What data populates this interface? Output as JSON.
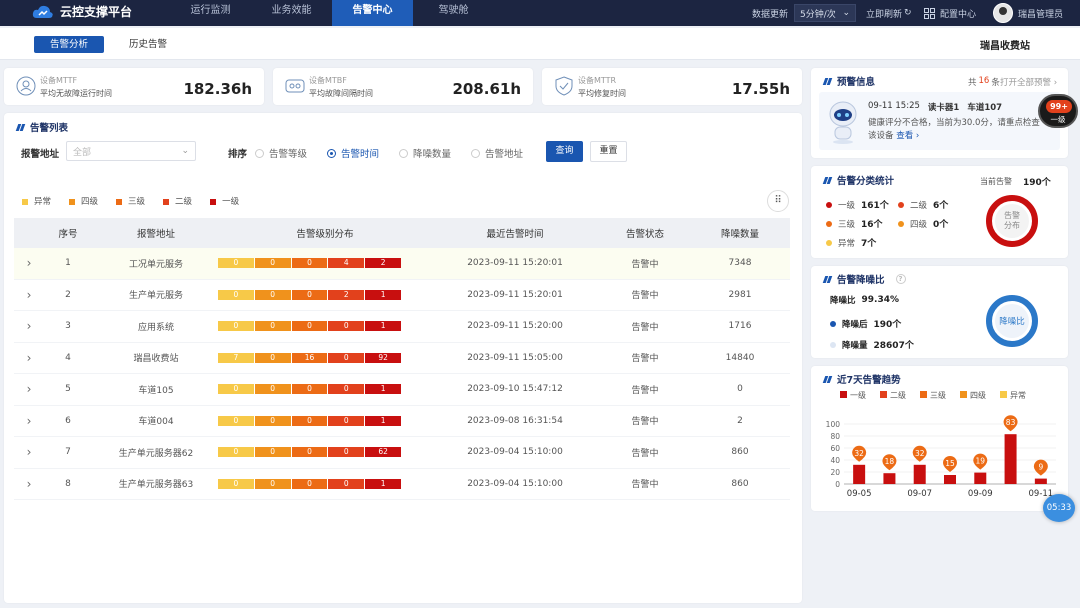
{
  "app": {
    "title": "云控支撑平台"
  },
  "nav": [
    {
      "label": "运行监测"
    },
    {
      "label": "业务效能"
    },
    {
      "label": "告警中心"
    },
    {
      "label": "驾驶舱"
    }
  ],
  "topright": {
    "refresh_label": "数据更新",
    "interval": "5分钟/次",
    "refresh_now": "立即刷新",
    "config": "配置中心",
    "user": "瑞昌管理员"
  },
  "subtabs": [
    {
      "label": "告警分析"
    },
    {
      "label": "历史告警"
    }
  ],
  "station": "瑞昌收费站",
  "kpis": [
    {
      "name": "设备MTTF",
      "desc": "平均无故障运行时间",
      "value": "182.36h"
    },
    {
      "name": "设备MTBF",
      "desc": "平均故障间隔时间",
      "value": "208.61h"
    },
    {
      "name": "设备MTTR",
      "desc": "平均修复时间",
      "value": "17.55h"
    }
  ],
  "alarm_list": {
    "title": "告警列表",
    "address_label": "报警地址",
    "address_placeholder": "全部",
    "sort_label": "排序",
    "sort_options": [
      "告警等级",
      "告警时间",
      "降噪数量",
      "告警地址"
    ],
    "sort_selected": "告警时间",
    "query_btn": "查询",
    "reset_btn": "重置",
    "legend": [
      "异常",
      "四级",
      "三级",
      "二级",
      "一级"
    ],
    "legend_colors": [
      "#f7c948",
      "#f0921c",
      "#ec6b15",
      "#e2411c",
      "#c80f0f"
    ],
    "columns": [
      "序号",
      "报警地址",
      "告警级别分布",
      "最近告警时间",
      "告警状态",
      "降噪数量"
    ],
    "rows": [
      {
        "no": "1",
        "addr": "工况单元服务",
        "levels": [
          "0",
          "0",
          "0",
          "4",
          "2"
        ],
        "time": "2023-09-11 15:20:01",
        "status": "告警中",
        "count": "7348"
      },
      {
        "no": "2",
        "addr": "生产单元服务",
        "levels": [
          "0",
          "0",
          "0",
          "2",
          "1"
        ],
        "time": "2023-09-11 15:20:01",
        "status": "告警中",
        "count": "2981"
      },
      {
        "no": "3",
        "addr": "应用系统",
        "levels": [
          "0",
          "0",
          "0",
          "0",
          "1"
        ],
        "time": "2023-09-11 15:20:00",
        "status": "告警中",
        "count": "1716"
      },
      {
        "no": "4",
        "addr": "瑞昌收费站",
        "levels": [
          "7",
          "0",
          "16",
          "0",
          "92"
        ],
        "time": "2023-09-11 15:05:00",
        "status": "告警中",
        "count": "14840"
      },
      {
        "no": "5",
        "addr": "车道105",
        "levels": [
          "0",
          "0",
          "0",
          "0",
          "1"
        ],
        "time": "2023-09-10 15:47:12",
        "status": "告警中",
        "count": "0"
      },
      {
        "no": "6",
        "addr": "车道004",
        "levels": [
          "0",
          "0",
          "0",
          "0",
          "1"
        ],
        "time": "2023-09-08 16:31:54",
        "status": "告警中",
        "count": "2"
      },
      {
        "no": "7",
        "addr": "生产单元服务器62",
        "levels": [
          "0",
          "0",
          "0",
          "0",
          "62"
        ],
        "time": "2023-09-04 15:10:00",
        "status": "告警中",
        "count": "860"
      },
      {
        "no": "8",
        "addr": "生产单元服务器63",
        "levels": [
          "0",
          "0",
          "0",
          "0",
          "1"
        ],
        "time": "2023-09-04 15:10:00",
        "status": "告警中",
        "count": "860"
      }
    ]
  },
  "warning_info": {
    "title": "预警信息",
    "total_prefix": "共",
    "total": "16",
    "total_suffix": "条",
    "open_all": "打开全部预警",
    "time": "09-11 15:25",
    "device": "读卡器1",
    "lane": "车道107",
    "message": "健康评分不合格，当前为30.0分，请重点检查该设备",
    "view": "查看",
    "badge": "99+",
    "badge_sub": "一级"
  },
  "category_stats": {
    "title": "告警分类统计",
    "current_label": "当前告警",
    "current_value": "190个",
    "items": [
      {
        "label": "一级",
        "value": "161个",
        "color": "#c80f0f"
      },
      {
        "label": "二级",
        "value": "6个",
        "color": "#e2411c"
      },
      {
        "label": "三级",
        "value": "16个",
        "color": "#ec6b15"
      },
      {
        "label": "四级",
        "value": "0个",
        "color": "#f0921c"
      },
      {
        "label": "异常",
        "value": "7个",
        "color": "#f7c948"
      }
    ],
    "donut_label1": "告警",
    "donut_label2": "分布"
  },
  "noise": {
    "title": "告警降噪比",
    "ratio_label": "降噪比",
    "ratio": "99.34%",
    "after_label": "降噪后",
    "after": "190个",
    "amount_label": "降噪量",
    "amount": "28607个",
    "donut_label": "降噪比"
  },
  "chart_data": {
    "type": "bar",
    "title": "近7天告警趋势",
    "legend": [
      "一级",
      "二级",
      "三级",
      "四级",
      "异常"
    ],
    "legend_colors": [
      "#c80f0f",
      "#e2411c",
      "#ec6b15",
      "#f0921c",
      "#f7c948"
    ],
    "x_ticks": [
      "09-05",
      "09-07",
      "09-09",
      "09-11"
    ],
    "categories": [
      "09-05",
      "09-06",
      "09-07",
      "09-08",
      "09-09",
      "09-10",
      "09-11"
    ],
    "values": [
      32,
      18,
      32,
      15,
      19,
      83,
      9
    ],
    "yticks": [
      0,
      20,
      40,
      60,
      80,
      100
    ],
    "ylim": [
      0,
      100
    ]
  },
  "clock": "05:33"
}
